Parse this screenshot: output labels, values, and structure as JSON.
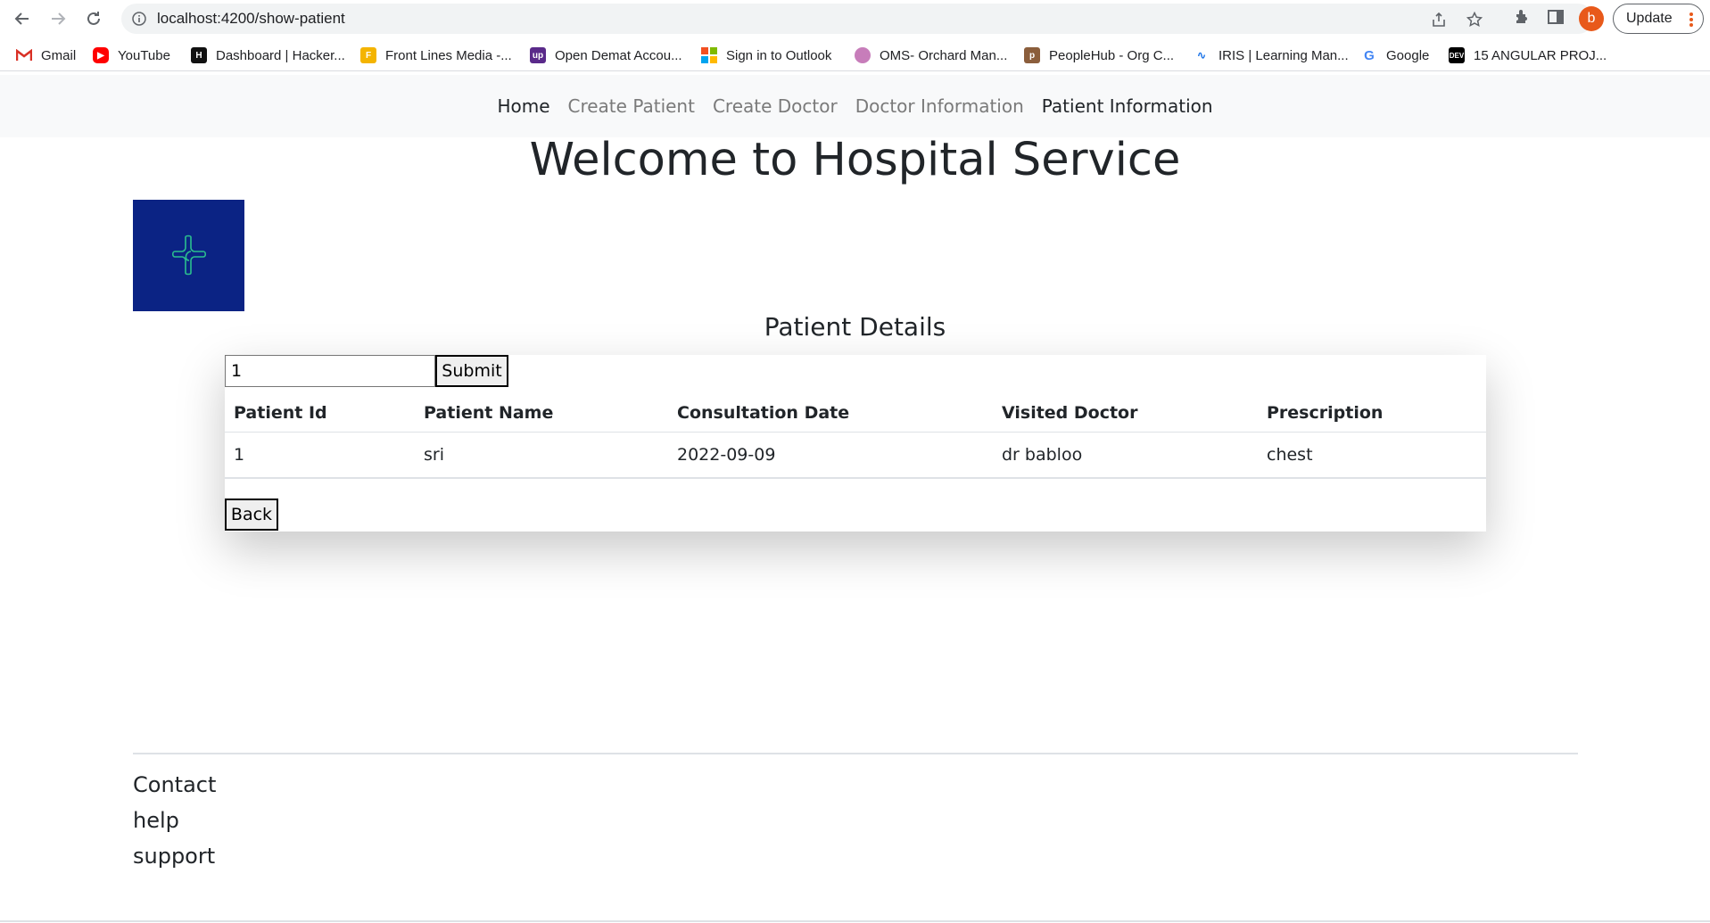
{
  "browser": {
    "url": "localhost:4200/show-patient",
    "profile_initial": "b",
    "update_label": "Update",
    "bookmarks": [
      {
        "label": "Gmail",
        "icon": "gmail-icon"
      },
      {
        "label": "YouTube",
        "icon": "youtube-icon"
      },
      {
        "label": "Dashboard | Hacker...",
        "icon": "hackerrank-icon"
      },
      {
        "label": "Front Lines Media -...",
        "icon": "frontlines-icon"
      },
      {
        "label": "Open Demat Accou...",
        "icon": "upstox-icon"
      },
      {
        "label": "Sign in to Outlook",
        "icon": "microsoft-icon"
      },
      {
        "label": "OMS- Orchard Man...",
        "icon": "oms-icon"
      },
      {
        "label": "PeopleHub - Org C...",
        "icon": "peoplehub-icon"
      },
      {
        "label": "IRIS | Learning Man...",
        "icon": "iris-icon"
      },
      {
        "label": "Google",
        "icon": "google-icon"
      },
      {
        "label": "15 ANGULAR PROJ...",
        "icon": "dev-icon"
      }
    ]
  },
  "nav": {
    "items": [
      {
        "label": "Home",
        "active": true
      },
      {
        "label": "Create Patient",
        "active": false
      },
      {
        "label": "Create Doctor",
        "active": false
      },
      {
        "label": "Doctor Information",
        "active": false
      },
      {
        "label": "Patient Information",
        "active": true
      }
    ]
  },
  "header": {
    "title": "Welcome to Hospital Service"
  },
  "details": {
    "title": "Patient Details",
    "search_value": "1",
    "submit_label": "Submit",
    "back_label": "Back",
    "columns": [
      "Patient Id",
      "Patient Name",
      "Consultation Date",
      "Visited Doctor",
      "Prescription"
    ],
    "rows": [
      [
        "1",
        "sri",
        "2022-09-09",
        "dr babloo",
        "chest"
      ]
    ]
  },
  "footer": {
    "links": [
      "Contact",
      "help",
      "support"
    ]
  },
  "colors": {
    "logo_bg": "#0b2384",
    "nav_bg": "#f8f9fa",
    "profile": "#e8591a"
  }
}
